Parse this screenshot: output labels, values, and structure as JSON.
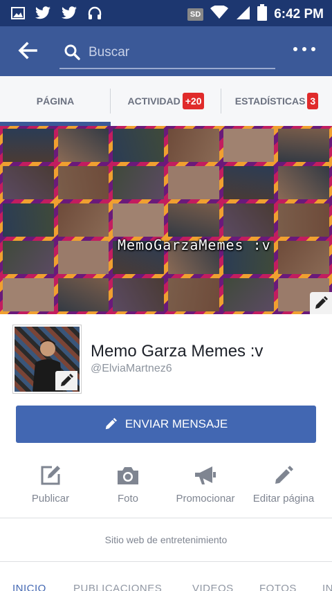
{
  "status_bar": {
    "time": "6:42 PM",
    "sd_label": "SD",
    "left_icons": [
      "image-icon",
      "twitter-icon",
      "twitter-icon",
      "headphones-icon"
    ],
    "right_icons": [
      "wifi-icon",
      "signal-icon",
      "battery-icon"
    ]
  },
  "app_bar": {
    "search_placeholder": "Buscar"
  },
  "tabs": [
    {
      "label": "PÁGINA",
      "badge": ""
    },
    {
      "label": "ACTIVIDAD",
      "badge": "+20"
    },
    {
      "label": "ESTADÍSTICAS",
      "badge": "3"
    }
  ],
  "cover": {
    "caption": "MemoGarzaMemes :v"
  },
  "profile": {
    "name": "Memo Garza Memes :v",
    "handle": "@ElviaMartnez6"
  },
  "send_button": {
    "label": "ENVIAR MENSAJE"
  },
  "actions": [
    {
      "label": "Publicar",
      "icon": "compose-icon"
    },
    {
      "label": "Foto",
      "icon": "camera-icon"
    },
    {
      "label": "Promocionar",
      "icon": "megaphone-icon"
    },
    {
      "label": "Editar página",
      "icon": "pencil-icon"
    }
  ],
  "category": "Sitio web de entretenimiento",
  "bottom_tabs": [
    "INICIO",
    "PUBLICACIONES",
    "VIDEOS",
    "FOTOS",
    "IN"
  ],
  "colors": {
    "status_bar": "#1d3770",
    "brand_blue": "#3b5998",
    "button_blue": "#4267b2",
    "badge_red": "#e02b2b"
  }
}
